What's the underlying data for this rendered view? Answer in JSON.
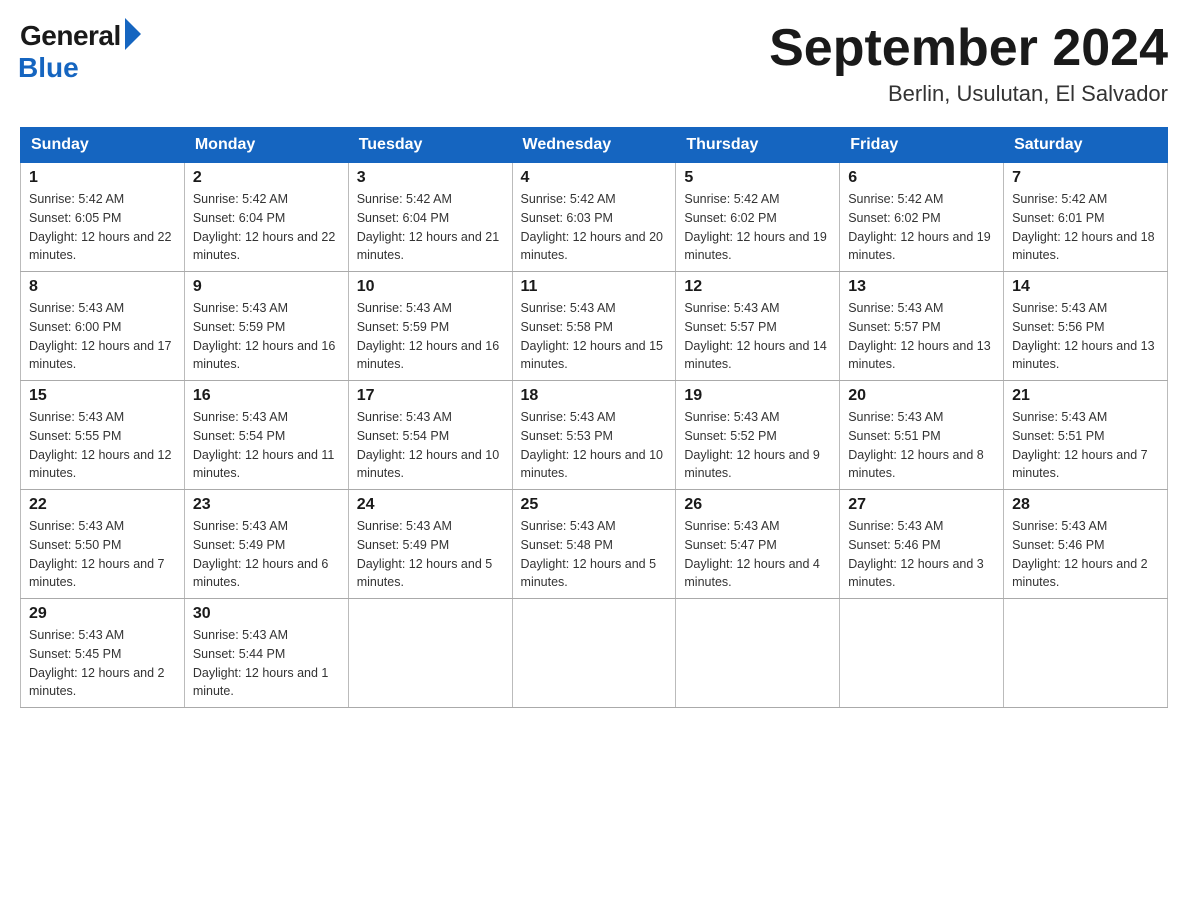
{
  "logo": {
    "general": "General",
    "blue": "Blue"
  },
  "title": {
    "month_year": "September 2024",
    "location": "Berlin, Usulutan, El Salvador"
  },
  "headers": [
    "Sunday",
    "Monday",
    "Tuesday",
    "Wednesday",
    "Thursday",
    "Friday",
    "Saturday"
  ],
  "weeks": [
    [
      {
        "day": "1",
        "sunrise": "5:42 AM",
        "sunset": "6:05 PM",
        "daylight": "12 hours and 22 minutes."
      },
      {
        "day": "2",
        "sunrise": "5:42 AM",
        "sunset": "6:04 PM",
        "daylight": "12 hours and 22 minutes."
      },
      {
        "day": "3",
        "sunrise": "5:42 AM",
        "sunset": "6:04 PM",
        "daylight": "12 hours and 21 minutes."
      },
      {
        "day": "4",
        "sunrise": "5:42 AM",
        "sunset": "6:03 PM",
        "daylight": "12 hours and 20 minutes."
      },
      {
        "day": "5",
        "sunrise": "5:42 AM",
        "sunset": "6:02 PM",
        "daylight": "12 hours and 19 minutes."
      },
      {
        "day": "6",
        "sunrise": "5:42 AM",
        "sunset": "6:02 PM",
        "daylight": "12 hours and 19 minutes."
      },
      {
        "day": "7",
        "sunrise": "5:42 AM",
        "sunset": "6:01 PM",
        "daylight": "12 hours and 18 minutes."
      }
    ],
    [
      {
        "day": "8",
        "sunrise": "5:43 AM",
        "sunset": "6:00 PM",
        "daylight": "12 hours and 17 minutes."
      },
      {
        "day": "9",
        "sunrise": "5:43 AM",
        "sunset": "5:59 PM",
        "daylight": "12 hours and 16 minutes."
      },
      {
        "day": "10",
        "sunrise": "5:43 AM",
        "sunset": "5:59 PM",
        "daylight": "12 hours and 16 minutes."
      },
      {
        "day": "11",
        "sunrise": "5:43 AM",
        "sunset": "5:58 PM",
        "daylight": "12 hours and 15 minutes."
      },
      {
        "day": "12",
        "sunrise": "5:43 AM",
        "sunset": "5:57 PM",
        "daylight": "12 hours and 14 minutes."
      },
      {
        "day": "13",
        "sunrise": "5:43 AM",
        "sunset": "5:57 PM",
        "daylight": "12 hours and 13 minutes."
      },
      {
        "day": "14",
        "sunrise": "5:43 AM",
        "sunset": "5:56 PM",
        "daylight": "12 hours and 13 minutes."
      }
    ],
    [
      {
        "day": "15",
        "sunrise": "5:43 AM",
        "sunset": "5:55 PM",
        "daylight": "12 hours and 12 minutes."
      },
      {
        "day": "16",
        "sunrise": "5:43 AM",
        "sunset": "5:54 PM",
        "daylight": "12 hours and 11 minutes."
      },
      {
        "day": "17",
        "sunrise": "5:43 AM",
        "sunset": "5:54 PM",
        "daylight": "12 hours and 10 minutes."
      },
      {
        "day": "18",
        "sunrise": "5:43 AM",
        "sunset": "5:53 PM",
        "daylight": "12 hours and 10 minutes."
      },
      {
        "day": "19",
        "sunrise": "5:43 AM",
        "sunset": "5:52 PM",
        "daylight": "12 hours and 9 minutes."
      },
      {
        "day": "20",
        "sunrise": "5:43 AM",
        "sunset": "5:51 PM",
        "daylight": "12 hours and 8 minutes."
      },
      {
        "day": "21",
        "sunrise": "5:43 AM",
        "sunset": "5:51 PM",
        "daylight": "12 hours and 7 minutes."
      }
    ],
    [
      {
        "day": "22",
        "sunrise": "5:43 AM",
        "sunset": "5:50 PM",
        "daylight": "12 hours and 7 minutes."
      },
      {
        "day": "23",
        "sunrise": "5:43 AM",
        "sunset": "5:49 PM",
        "daylight": "12 hours and 6 minutes."
      },
      {
        "day": "24",
        "sunrise": "5:43 AM",
        "sunset": "5:49 PM",
        "daylight": "12 hours and 5 minutes."
      },
      {
        "day": "25",
        "sunrise": "5:43 AM",
        "sunset": "5:48 PM",
        "daylight": "12 hours and 5 minutes."
      },
      {
        "day": "26",
        "sunrise": "5:43 AM",
        "sunset": "5:47 PM",
        "daylight": "12 hours and 4 minutes."
      },
      {
        "day": "27",
        "sunrise": "5:43 AM",
        "sunset": "5:46 PM",
        "daylight": "12 hours and 3 minutes."
      },
      {
        "day": "28",
        "sunrise": "5:43 AM",
        "sunset": "5:46 PM",
        "daylight": "12 hours and 2 minutes."
      }
    ],
    [
      {
        "day": "29",
        "sunrise": "5:43 AM",
        "sunset": "5:45 PM",
        "daylight": "12 hours and 2 minutes."
      },
      {
        "day": "30",
        "sunrise": "5:43 AM",
        "sunset": "5:44 PM",
        "daylight": "12 hours and 1 minute."
      },
      null,
      null,
      null,
      null,
      null
    ]
  ]
}
